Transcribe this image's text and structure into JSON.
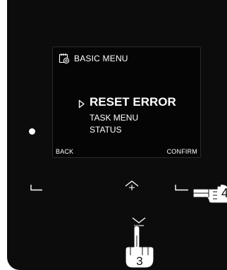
{
  "screen": {
    "title": "BASIC MENU",
    "title_icon": "calendar-gear-icon",
    "menu_items": [
      {
        "label": "RESET ERROR",
        "selected": true
      },
      {
        "label": "TASK MENU",
        "selected": false
      },
      {
        "label": "STATUS",
        "selected": false
      }
    ],
    "softkeys": {
      "left_label": "BACK",
      "right_label": "CONFIRM"
    }
  },
  "panel": {
    "led_icon": "status-led",
    "keys": [
      {
        "name": "left-softkey",
        "icon": "left-bracket-icon"
      },
      {
        "name": "up-key",
        "icon": "chevron-up-icon"
      },
      {
        "name": "right-softkey",
        "icon": "right-bracket-icon"
      },
      {
        "name": "down-key",
        "icon": "chevron-down-icon"
      }
    ]
  },
  "callouts": [
    {
      "target": "right-softkey",
      "number": "4"
    },
    {
      "target": "down-key",
      "number": "3"
    }
  ],
  "colors": {
    "device_body": "#0c0c0c",
    "screen_bg": "#050505",
    "text": "#ffffff"
  }
}
